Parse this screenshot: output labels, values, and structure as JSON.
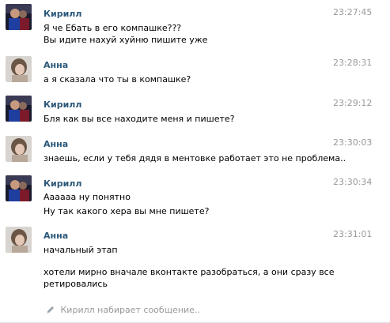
{
  "messages": [
    {
      "sender": "Кирилл",
      "avatar": "kirill-avatar",
      "time": "23:27:45",
      "lines": [
        "Я че Ебать в его компашке???",
        "Вы идите нахуй хуйню пишите уже"
      ]
    },
    {
      "sender": "Анна",
      "avatar": "anna-avatar",
      "time": "23:28:31",
      "lines": [
        "а я сказала что ты в компашке?"
      ]
    },
    {
      "sender": "Кирилл",
      "avatar": "kirill-avatar",
      "time": "23:29:12",
      "lines": [
        "Бля как вы все находите меня и пишете?"
      ]
    },
    {
      "sender": "Анна",
      "avatar": "anna-avatar",
      "time": "23:30:03",
      "lines": [
        "знаешь, если у тебя дядя в ментовке работает это не проблема.."
      ]
    },
    {
      "sender": "Кирилл",
      "avatar": "kirill-avatar",
      "time": "23:30:34",
      "lines": [
        "Аааааа ну понятно",
        "Ну так какого хера вы мне пишете?"
      ]
    },
    {
      "sender": "Анна",
      "avatar": "anna-avatar",
      "time": "23:31:01",
      "lines": [
        "начальный этап",
        "хотели мирно вначале вконтакте разобраться, а они сразу все",
        "ретировались"
      ]
    }
  ],
  "typing_indicator": {
    "icon": "pencil-icon",
    "text": "Кирилл набирает сообщение.."
  },
  "colors": {
    "name": "#2b587a",
    "time": "#999999",
    "text": "#000000"
  }
}
